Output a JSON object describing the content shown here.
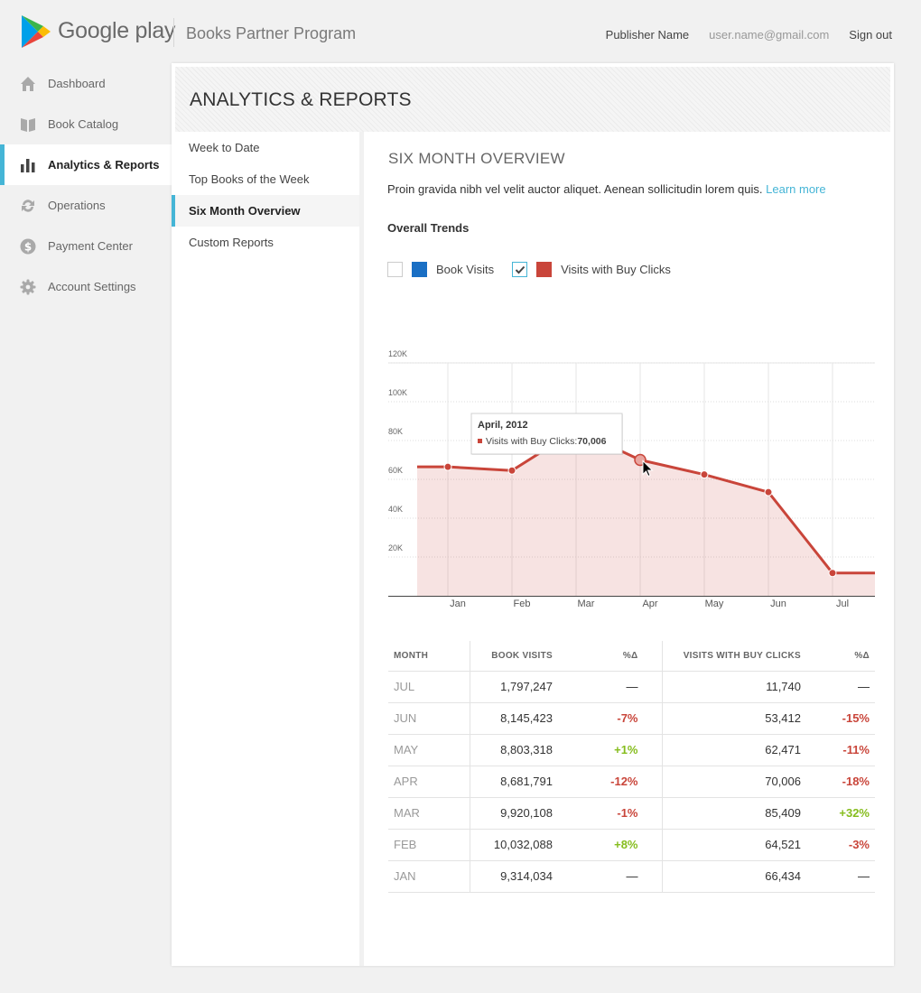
{
  "header": {
    "brand": "Google play",
    "program": "Books Partner Program",
    "publisher": "Publisher Name",
    "email": "user.name@gmail.com",
    "signout": "Sign out"
  },
  "sidebar": {
    "items": [
      {
        "label": "Dashboard",
        "icon": "home-icon"
      },
      {
        "label": "Book Catalog",
        "icon": "book-icon"
      },
      {
        "label": "Analytics & Reports",
        "icon": "bar-chart-icon",
        "active": true
      },
      {
        "label": "Operations",
        "icon": "sync-icon"
      },
      {
        "label": "Payment Center",
        "icon": "dollar-icon"
      },
      {
        "label": "Account Settings",
        "icon": "gear-icon"
      }
    ]
  },
  "page": {
    "title": "ANALYTICS & REPORTS"
  },
  "subnav": {
    "items": [
      {
        "label": "Week to Date"
      },
      {
        "label": "Top Books of the Week"
      },
      {
        "label": "Six Month Overview",
        "active": true
      },
      {
        "label": "Custom Reports"
      }
    ]
  },
  "section": {
    "title": "SIX MONTH OVERVIEW",
    "description": "Proin gravida nibh vel velit auctor aliquet. Aenean sollicitudin lorem quis.",
    "learn_more": "Learn more",
    "trends_title": "Overall Trends"
  },
  "legend": {
    "book_visits": "Book Visits",
    "buy_clicks": "Visits with Buy Clicks"
  },
  "colors": {
    "accent": "#45b5d6",
    "book_visits": "#1a6fc4",
    "buy_clicks": "#c9453a",
    "positive": "#86bd1e",
    "negative": "#c9453a"
  },
  "chart_data": {
    "type": "area",
    "categories": [
      "Jan",
      "Feb",
      "Mar",
      "Apr",
      "May",
      "Jun",
      "Jul"
    ],
    "ylim": [
      0,
      120000
    ],
    "yticks": [
      20000,
      40000,
      60000,
      80000,
      100000,
      120000
    ],
    "ytick_labels": [
      "20K",
      "40K",
      "60K",
      "80K",
      "100K",
      "120K"
    ],
    "grid": true,
    "series": [
      {
        "name": "Visits with Buy Clicks",
        "values": [
          66434,
          64521,
          85409,
          70006,
          62471,
          53412,
          11740
        ],
        "visible": true
      },
      {
        "name": "Book Visits",
        "visible": false
      }
    ],
    "tooltip": {
      "title": "April, 2012",
      "label": "Visits with Buy Clicks:",
      "value": "70,006",
      "category_index": 3
    }
  },
  "table": {
    "headers": {
      "month": "MONTH",
      "book_visits": "BOOK VISITS",
      "bv_pct": "%Δ",
      "buy_clicks": "VISITS WITH BUY CLICKS",
      "bc_pct": "%Δ"
    },
    "rows": [
      {
        "month": "JUL",
        "bv": "1,797,247",
        "bvp": "—",
        "bc": "11,740",
        "bcp": "—"
      },
      {
        "month": "JUN",
        "bv": "8,145,423",
        "bvp": "-7%",
        "bc": "53,412",
        "bcp": "-15%"
      },
      {
        "month": "MAY",
        "bv": "8,803,318",
        "bvp": "+1%",
        "bc": "62,471",
        "bcp": "-11%"
      },
      {
        "month": "APR",
        "bv": "8,681,791",
        "bvp": "-12%",
        "bc": "70,006",
        "bcp": "-18%"
      },
      {
        "month": "MAR",
        "bv": "9,920,108",
        "bvp": "-1%",
        "bc": "85,409",
        "bcp": "+32%"
      },
      {
        "month": "FEB",
        "bv": "10,032,088",
        "bvp": "+8%",
        "bc": "64,521",
        "bcp": "-3%"
      },
      {
        "month": "JAN",
        "bv": "9,314,034",
        "bvp": "—",
        "bc": "66,434",
        "bcp": "—"
      }
    ]
  }
}
